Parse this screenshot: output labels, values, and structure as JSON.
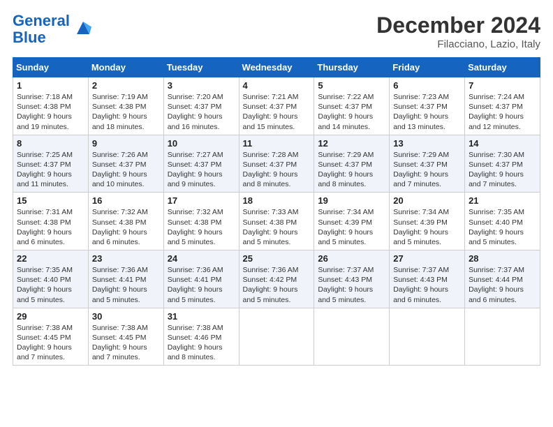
{
  "header": {
    "logo_line1": "General",
    "logo_line2": "Blue",
    "month": "December 2024",
    "location": "Filacciano, Lazio, Italy"
  },
  "weekdays": [
    "Sunday",
    "Monday",
    "Tuesday",
    "Wednesday",
    "Thursday",
    "Friday",
    "Saturday"
  ],
  "weeks": [
    [
      {
        "day": "1",
        "info": "Sunrise: 7:18 AM\nSunset: 4:38 PM\nDaylight: 9 hours\nand 19 minutes."
      },
      {
        "day": "2",
        "info": "Sunrise: 7:19 AM\nSunset: 4:38 PM\nDaylight: 9 hours\nand 18 minutes."
      },
      {
        "day": "3",
        "info": "Sunrise: 7:20 AM\nSunset: 4:37 PM\nDaylight: 9 hours\nand 16 minutes."
      },
      {
        "day": "4",
        "info": "Sunrise: 7:21 AM\nSunset: 4:37 PM\nDaylight: 9 hours\nand 15 minutes."
      },
      {
        "day": "5",
        "info": "Sunrise: 7:22 AM\nSunset: 4:37 PM\nDaylight: 9 hours\nand 14 minutes."
      },
      {
        "day": "6",
        "info": "Sunrise: 7:23 AM\nSunset: 4:37 PM\nDaylight: 9 hours\nand 13 minutes."
      },
      {
        "day": "7",
        "info": "Sunrise: 7:24 AM\nSunset: 4:37 PM\nDaylight: 9 hours\nand 12 minutes."
      }
    ],
    [
      {
        "day": "8",
        "info": "Sunrise: 7:25 AM\nSunset: 4:37 PM\nDaylight: 9 hours\nand 11 minutes."
      },
      {
        "day": "9",
        "info": "Sunrise: 7:26 AM\nSunset: 4:37 PM\nDaylight: 9 hours\nand 10 minutes."
      },
      {
        "day": "10",
        "info": "Sunrise: 7:27 AM\nSunset: 4:37 PM\nDaylight: 9 hours\nand 9 minutes."
      },
      {
        "day": "11",
        "info": "Sunrise: 7:28 AM\nSunset: 4:37 PM\nDaylight: 9 hours\nand 8 minutes."
      },
      {
        "day": "12",
        "info": "Sunrise: 7:29 AM\nSunset: 4:37 PM\nDaylight: 9 hours\nand 8 minutes."
      },
      {
        "day": "13",
        "info": "Sunrise: 7:29 AM\nSunset: 4:37 PM\nDaylight: 9 hours\nand 7 minutes."
      },
      {
        "day": "14",
        "info": "Sunrise: 7:30 AM\nSunset: 4:37 PM\nDaylight: 9 hours\nand 7 minutes."
      }
    ],
    [
      {
        "day": "15",
        "info": "Sunrise: 7:31 AM\nSunset: 4:38 PM\nDaylight: 9 hours\nand 6 minutes."
      },
      {
        "day": "16",
        "info": "Sunrise: 7:32 AM\nSunset: 4:38 PM\nDaylight: 9 hours\nand 6 minutes."
      },
      {
        "day": "17",
        "info": "Sunrise: 7:32 AM\nSunset: 4:38 PM\nDaylight: 9 hours\nand 5 minutes."
      },
      {
        "day": "18",
        "info": "Sunrise: 7:33 AM\nSunset: 4:38 PM\nDaylight: 9 hours\nand 5 minutes."
      },
      {
        "day": "19",
        "info": "Sunrise: 7:34 AM\nSunset: 4:39 PM\nDaylight: 9 hours\nand 5 minutes."
      },
      {
        "day": "20",
        "info": "Sunrise: 7:34 AM\nSunset: 4:39 PM\nDaylight: 9 hours\nand 5 minutes."
      },
      {
        "day": "21",
        "info": "Sunrise: 7:35 AM\nSunset: 4:40 PM\nDaylight: 9 hours\nand 5 minutes."
      }
    ],
    [
      {
        "day": "22",
        "info": "Sunrise: 7:35 AM\nSunset: 4:40 PM\nDaylight: 9 hours\nand 5 minutes."
      },
      {
        "day": "23",
        "info": "Sunrise: 7:36 AM\nSunset: 4:41 PM\nDaylight: 9 hours\nand 5 minutes."
      },
      {
        "day": "24",
        "info": "Sunrise: 7:36 AM\nSunset: 4:41 PM\nDaylight: 9 hours\nand 5 minutes."
      },
      {
        "day": "25",
        "info": "Sunrise: 7:36 AM\nSunset: 4:42 PM\nDaylight: 9 hours\nand 5 minutes."
      },
      {
        "day": "26",
        "info": "Sunrise: 7:37 AM\nSunset: 4:43 PM\nDaylight: 9 hours\nand 5 minutes."
      },
      {
        "day": "27",
        "info": "Sunrise: 7:37 AM\nSunset: 4:43 PM\nDaylight: 9 hours\nand 6 minutes."
      },
      {
        "day": "28",
        "info": "Sunrise: 7:37 AM\nSunset: 4:44 PM\nDaylight: 9 hours\nand 6 minutes."
      }
    ],
    [
      {
        "day": "29",
        "info": "Sunrise: 7:38 AM\nSunset: 4:45 PM\nDaylight: 9 hours\nand 7 minutes."
      },
      {
        "day": "30",
        "info": "Sunrise: 7:38 AM\nSunset: 4:45 PM\nDaylight: 9 hours\nand 7 minutes."
      },
      {
        "day": "31",
        "info": "Sunrise: 7:38 AM\nSunset: 4:46 PM\nDaylight: 9 hours\nand 8 minutes."
      },
      null,
      null,
      null,
      null
    ]
  ]
}
